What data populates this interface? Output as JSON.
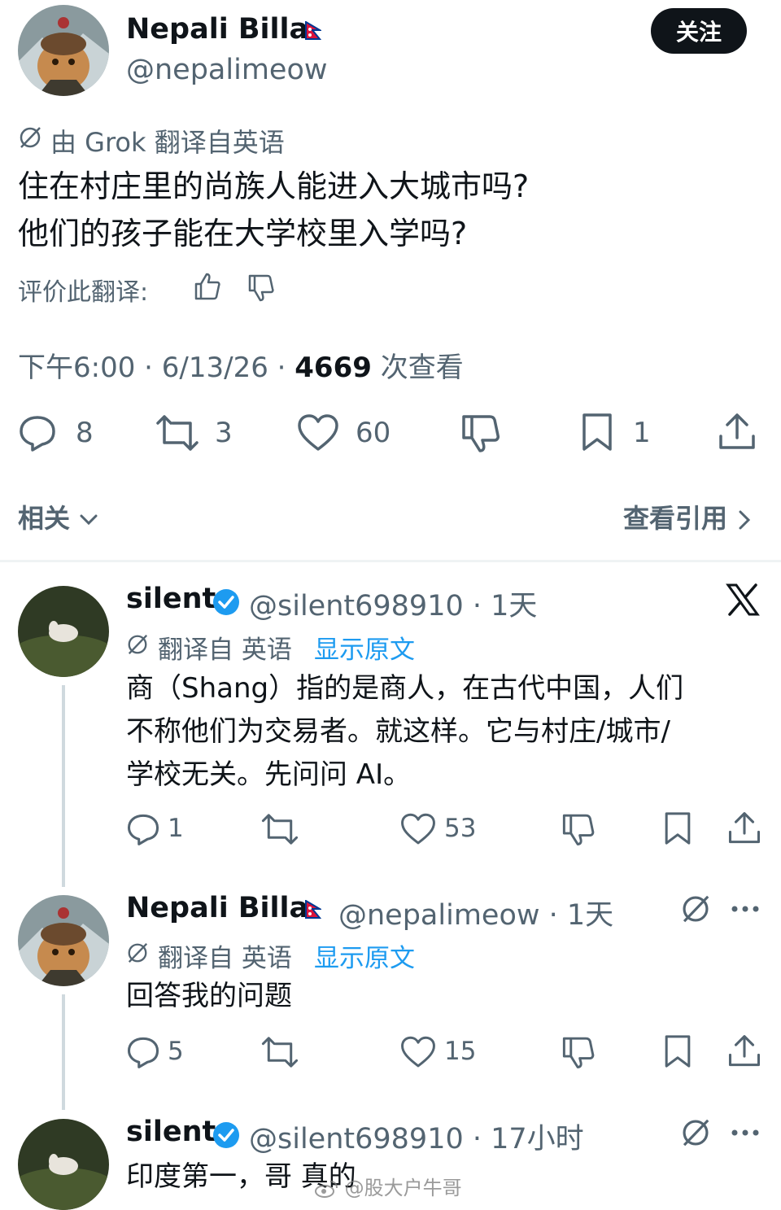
{
  "main_tweet": {
    "author_name": "Nepali Billa",
    "author_handle": "@nepalimeow",
    "follow_label": "关注",
    "translation_note": "由 Grok 翻译自英语",
    "text_line1": "住在村庄里的尚族人能进入大城市吗?",
    "text_line2": "他们的孩子能在大学校里入学吗?",
    "rate_translation": "评价此翻译:",
    "meta_time": "下午6:00 · 6/13/26 · ",
    "meta_views": "4669",
    "meta_views_label": " 次查看",
    "stats": {
      "replies": "8",
      "retweets": "3",
      "likes": "60",
      "bookmarks": "1"
    },
    "related_label": "相关",
    "quotes_label": "查看引用"
  },
  "replies": [
    {
      "author_name": "silent",
      "author_handle": "@silent698910 · 1天",
      "translation_note": "翻译自 英语",
      "show_original": "显示原文",
      "text_line1": "商（Shang）指的是商人，在古代中国，人们",
      "text_line2": "不称他们为交易者。就这样。它与村庄/城市/",
      "text_line3": "学校无关。先问问 AI。",
      "stats": {
        "replies": "1",
        "likes": "53"
      }
    },
    {
      "author_name": "Nepali Billa",
      "author_handle": "@nepalimeow · 1天",
      "translation_note": "翻译自 英语",
      "show_original": "显示原文",
      "text_line1": "回答我的问题",
      "stats": {
        "replies": "5",
        "likes": "15"
      }
    },
    {
      "author_name": "silent",
      "author_handle": "@silent698910 · 17小时",
      "text_line1": "印度第一，哥 真的"
    }
  ],
  "watermark": "@股大户牛哥",
  "icons": [
    "grok-icon",
    "thumbs-up-icon",
    "thumbs-down-icon",
    "reply-icon",
    "retweet-icon",
    "like-icon",
    "dislike-icon",
    "bookmark-icon",
    "share-icon",
    "verified-icon",
    "x-logo-icon",
    "more-icon",
    "nepal-flag-icon",
    "chevron-down-icon",
    "chevron-right-icon"
  ],
  "colors": {
    "accent": "#1d9bf0",
    "text": "#0f1419",
    "secondary": "#536471",
    "divider": "#eff3f4"
  }
}
